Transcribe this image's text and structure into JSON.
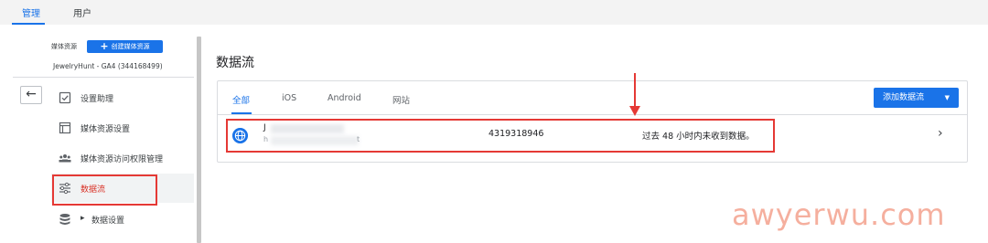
{
  "top_tabs": [
    {
      "label": "管理",
      "active": true
    },
    {
      "label": "用户",
      "active": false
    }
  ],
  "sidebar": {
    "property_label": "媒体资源",
    "create_button": "创建媒体资源",
    "account_name": "JewelryHunt - GA4 (344168499)",
    "back_icon": "arrow-left-icon",
    "items": [
      {
        "label": "设置助理",
        "icon": "checkbox-icon"
      },
      {
        "label": "媒体资源设置",
        "icon": "property-settings-icon"
      },
      {
        "label": "媒体资源访问权限管理",
        "icon": "people-icon"
      },
      {
        "label": "数据流",
        "icon": "data-streams-icon",
        "active": true
      },
      {
        "label": "数据设置",
        "icon": "database-icon",
        "expandable": true
      }
    ]
  },
  "main": {
    "title": "数据流",
    "tabs": [
      {
        "label": "全部",
        "active": true
      },
      {
        "label": "iOS",
        "active": false
      },
      {
        "label": "Android",
        "active": false
      },
      {
        "label": "网站",
        "active": false
      }
    ],
    "add_button": "添加数据流",
    "streams": [
      {
        "name_visible": "J",
        "url_visible_start": "h",
        "url_visible_end": "t",
        "id": "4319318946",
        "status": "过去 48 小时内未收到数据。",
        "icon": "globe-icon"
      }
    ]
  },
  "watermark": "awyerwu.com",
  "colors": {
    "accent": "#1a73e8",
    "highlight": "#e53935",
    "active_text": "#d93025"
  }
}
